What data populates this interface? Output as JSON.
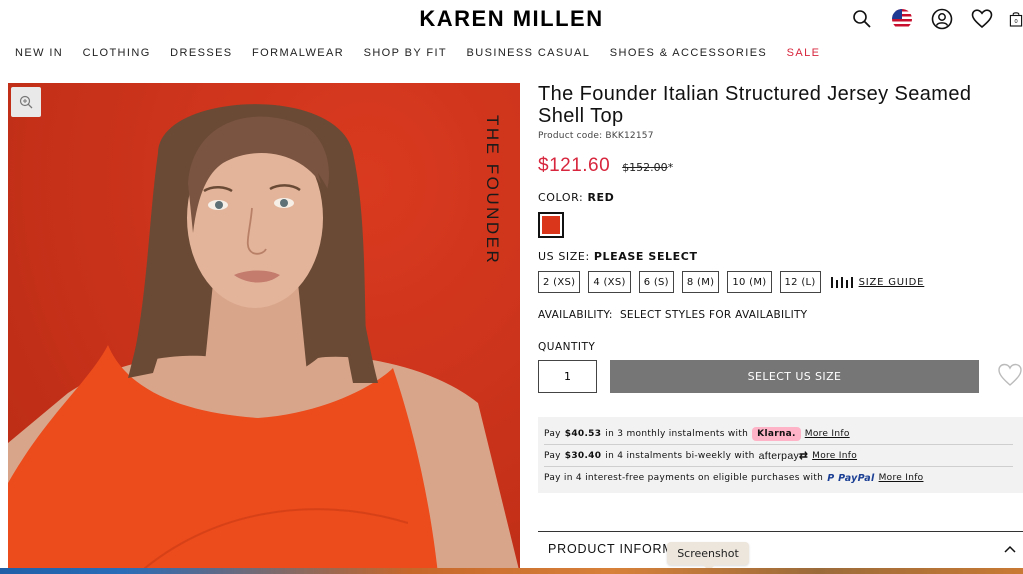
{
  "header": {
    "logo": "KAREN MILLEN",
    "icons": [
      "search-icon",
      "us-flag-icon",
      "account-icon",
      "wishlist-icon",
      "bag-icon"
    ],
    "bag_count": "0"
  },
  "nav": {
    "items": [
      {
        "label": "NEW IN"
      },
      {
        "label": "CLOTHING"
      },
      {
        "label": "DRESSES"
      },
      {
        "label": "FORMALWEAR"
      },
      {
        "label": "SHOP BY FIT"
      },
      {
        "label": "BUSINESS CASUAL"
      },
      {
        "label": "SHOES & ACCESSORIES"
      },
      {
        "label": "SALE"
      }
    ],
    "sale_color": "#d7263d"
  },
  "gallery": {
    "overlay_text": "THE FOUNDER",
    "background_color": "#c8321a"
  },
  "product": {
    "title": "The Founder Italian Structured Jersey Seamed Shell Top",
    "code_label": "Product code: BKK12157",
    "sale_price": "$121.60",
    "original_price": "$152.00",
    "price_marker": "*",
    "color_label": "COLOR:",
    "color_value": "RED",
    "swatch_color": "#d9361c",
    "size_label": "US SIZE:",
    "size_value": "PLEASE SELECT",
    "sizes": [
      "2 (XS)",
      "4 (XS)",
      "6 (S)",
      "8 (M)",
      "10 (M)",
      "12 (L)"
    ],
    "size_guide": "SIZE GUIDE",
    "availability": "AVAILABILITY:  SELECT STYLES FOR AVAILABILITY",
    "quantity_label": "QUANTITY",
    "quantity_value": "1",
    "add_button": "SELECT US SIZE"
  },
  "payments": {
    "klarna": {
      "pre": "Pay",
      "amount": "$40.53",
      "mid": "in 3 monthly instalments with",
      "brand": "Klarna.",
      "link": "More Info"
    },
    "afterpay": {
      "pre": "Pay",
      "amount": "$30.40",
      "mid": "in 4 instalments bi-weekly with",
      "brand": "afterpay",
      "link": "More Info"
    },
    "paypal": {
      "text": "Pay in 4 interest-free payments on eligible purchases with",
      "brand": "PayPal",
      "link": "More Info"
    }
  },
  "product_info": {
    "label": "PRODUCT INFORMATION"
  },
  "tooltip": "Screenshot"
}
